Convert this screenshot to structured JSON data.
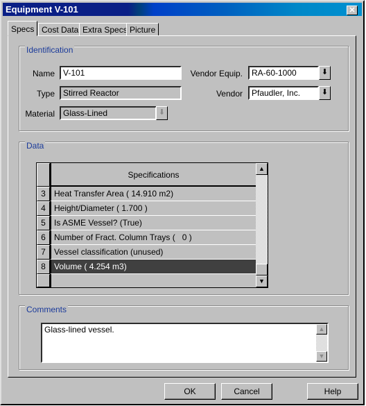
{
  "window": {
    "title": "Equipment V-101",
    "close": "✕"
  },
  "tabs": [
    {
      "label": "Specs",
      "active": true
    },
    {
      "label": "Cost Data"
    },
    {
      "label": "Extra Specs"
    },
    {
      "label": "Picture"
    }
  ],
  "identification": {
    "title": "Identification",
    "name_label": "Name",
    "name_value": "V-101",
    "type_label": "Type",
    "type_value": "Stirred Reactor",
    "material_label": "Material",
    "material_value": "Glass-Lined",
    "vendor_equip_label": "Vendor Equip.",
    "vendor_equip_value": "RA-60-1000",
    "vendor_label": "Vendor",
    "vendor_value": "Pfaudler, Inc."
  },
  "data": {
    "title": "Data",
    "header": "Specifications",
    "rows": [
      {
        "n": "3",
        "text": "Heat Transfer Area ( 14.910 m2)"
      },
      {
        "n": "4",
        "text": "Height/Diameter ( 1.700 )"
      },
      {
        "n": "5",
        "text": "Is ASME Vessel? (True)"
      },
      {
        "n": "6",
        "text": "Number of Fract. Column Trays (   0 )"
      },
      {
        "n": "7",
        "text": "Vessel classification (unused)"
      },
      {
        "n": "8",
        "text": "Volume ( 4.254 m3)",
        "selected": true
      }
    ]
  },
  "comments": {
    "title": "Comments",
    "value": "Glass-lined vessel."
  },
  "buttons": {
    "ok": "OK",
    "cancel": "Cancel",
    "help": "Help"
  }
}
